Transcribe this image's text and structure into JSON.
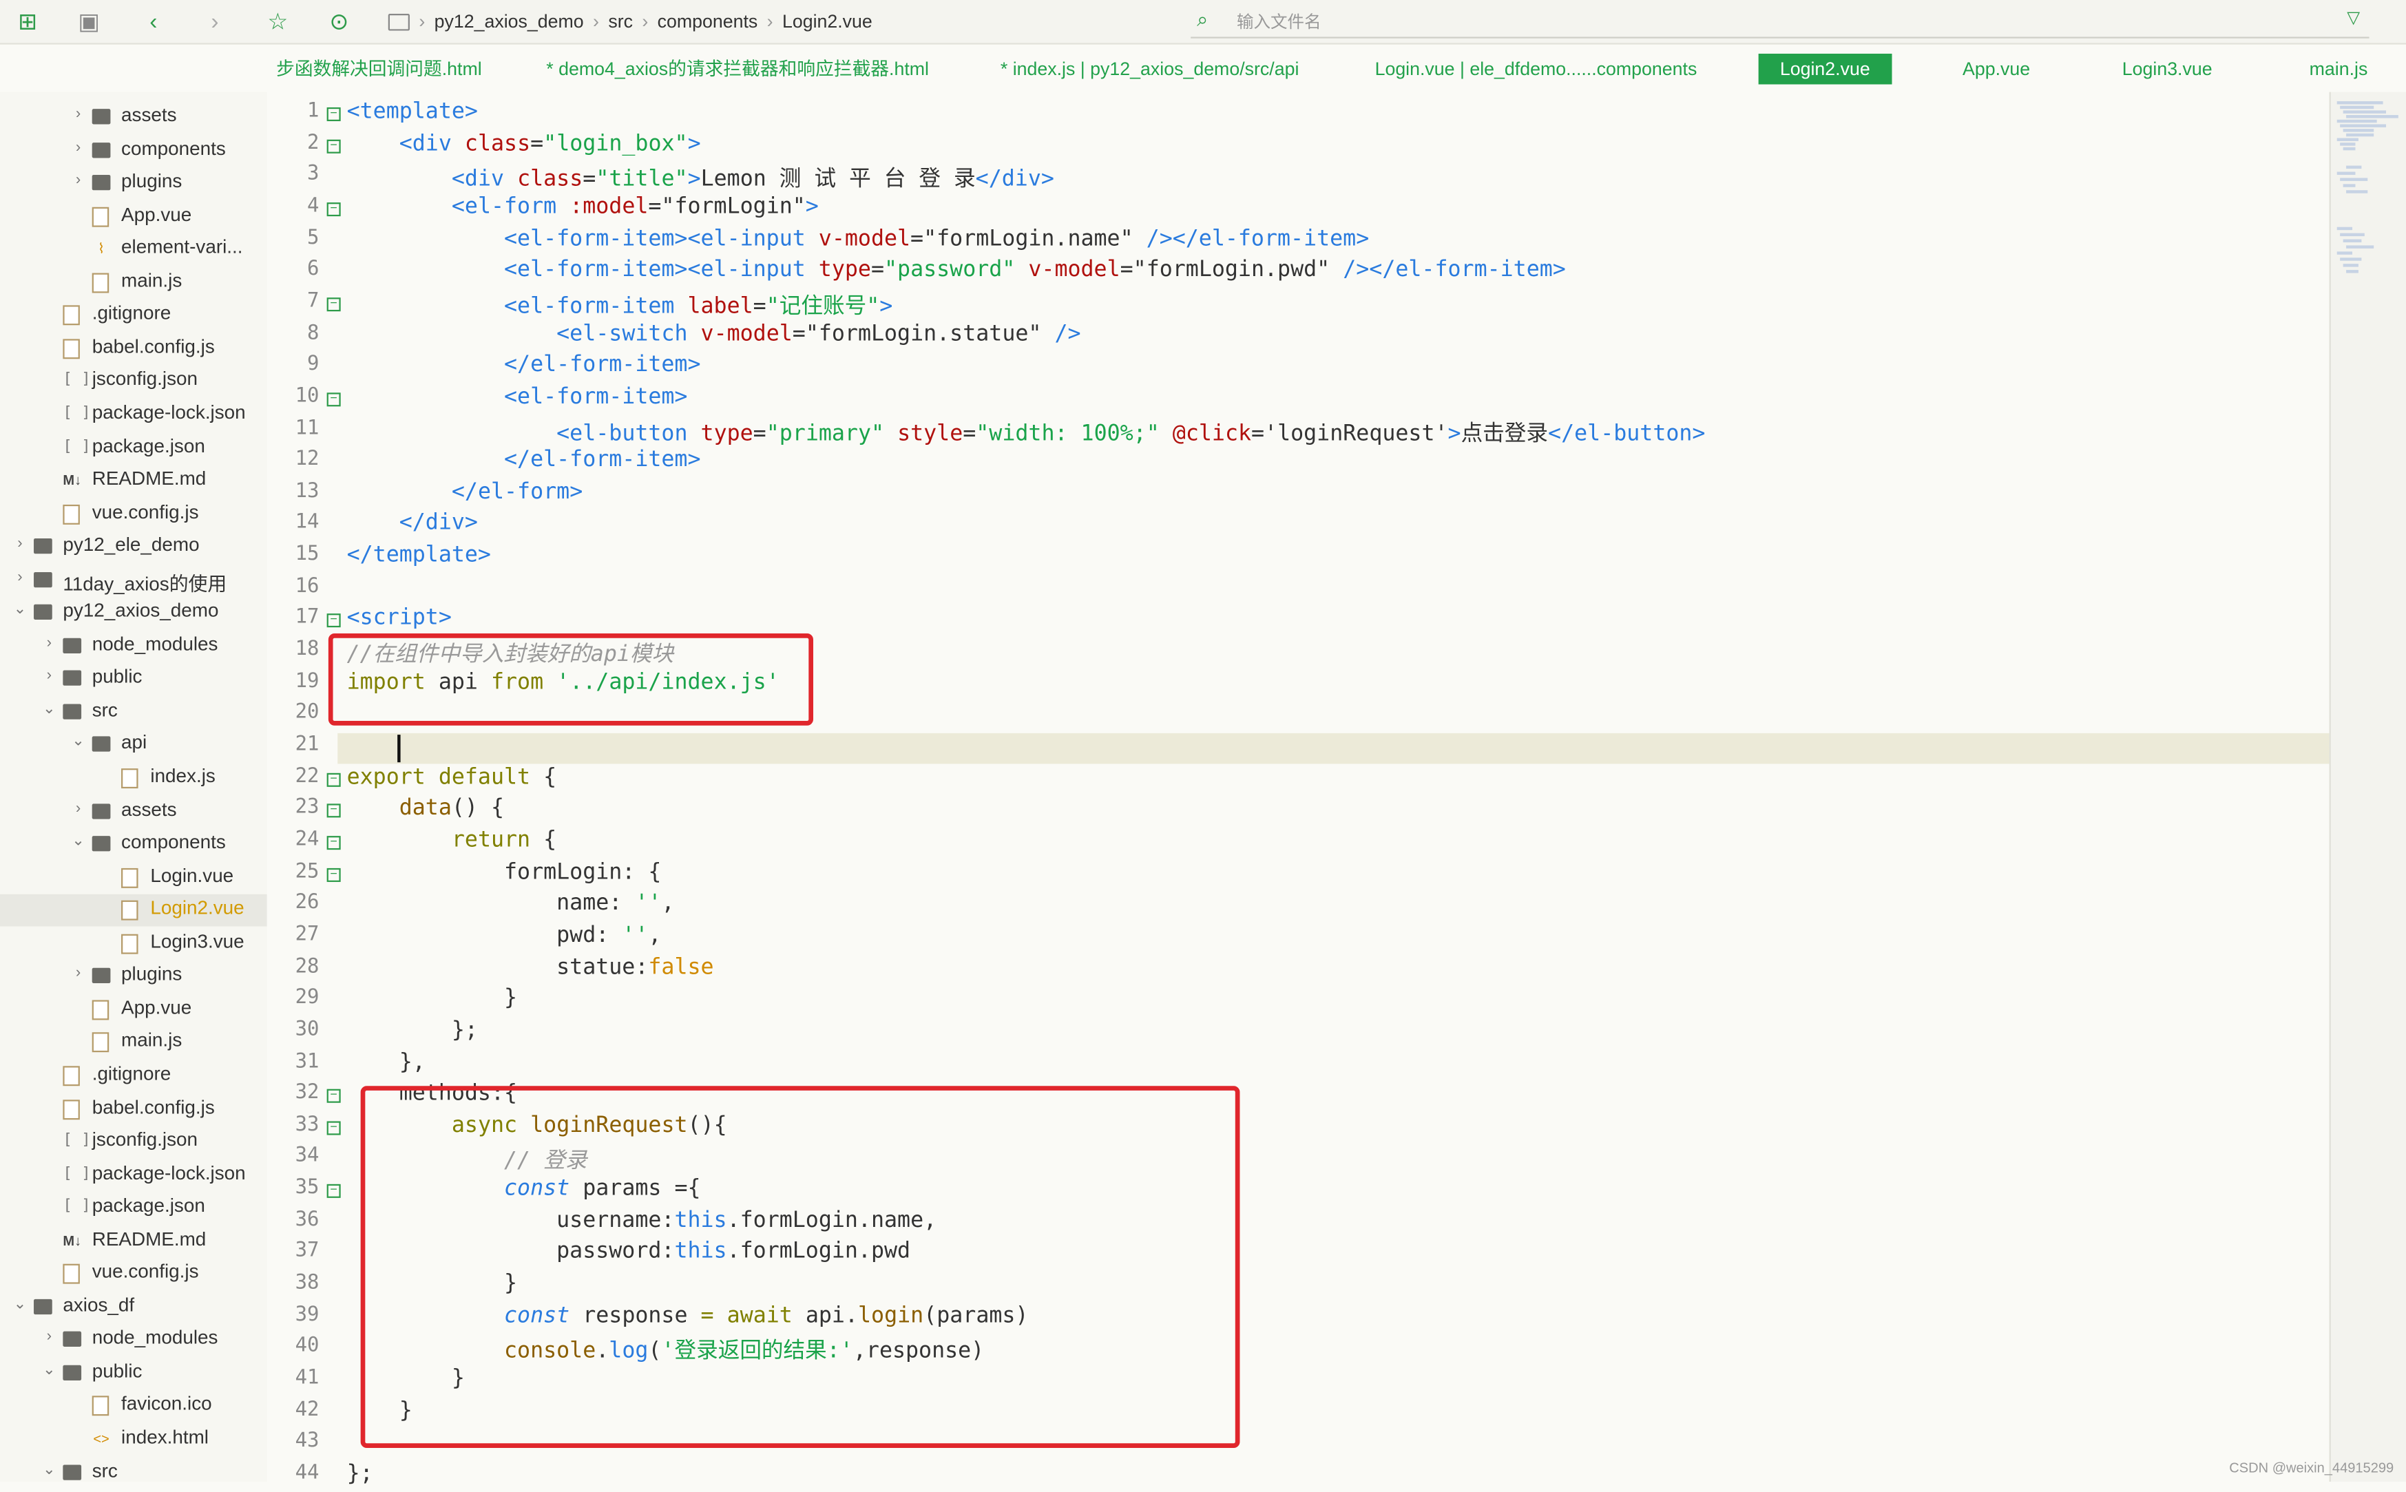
{
  "toolbar": {
    "breadcrumb": [
      "py12_axios_demo",
      "src",
      "components",
      "Login2.vue"
    ],
    "search_placeholder": "输入文件名",
    "icons": [
      "new-file-icon",
      "save-icon",
      "back-icon",
      "forward-icon",
      "star-icon",
      "run-icon",
      "folder-icon",
      "search-file-icon",
      "filter-icon"
    ]
  },
  "tabs": [
    {
      "label": "步函数解决回调问题.html",
      "active": false
    },
    {
      "label": "* demo4_axios的请求拦截器和响应拦截器.html",
      "active": false
    },
    {
      "label": "* index.js | py12_axios_demo/src/api",
      "active": false
    },
    {
      "label": "Login.vue | ele_dfdemo......components",
      "active": false
    },
    {
      "label": "Login2.vue",
      "active": true
    },
    {
      "label": "App.vue",
      "active": false
    },
    {
      "label": "Login3.vue",
      "active": false
    },
    {
      "label": "main.js",
      "active": false
    }
  ],
  "tree": [
    {
      "label": "assets",
      "kind": "folder",
      "depth": 2,
      "chevron": "›"
    },
    {
      "label": "components",
      "kind": "folder",
      "depth": 2,
      "chevron": "›"
    },
    {
      "label": "plugins",
      "kind": "folder",
      "depth": 2,
      "chevron": "›"
    },
    {
      "label": "App.vue",
      "kind": "file",
      "depth": 2,
      "chevron": ""
    },
    {
      "label": "element-vari...",
      "kind": "link",
      "depth": 2,
      "chevron": ""
    },
    {
      "label": "main.js",
      "kind": "file",
      "depth": 2,
      "chevron": ""
    },
    {
      "label": ".gitignore",
      "kind": "file",
      "depth": 1,
      "chevron": ""
    },
    {
      "label": "babel.config.js",
      "kind": "file",
      "depth": 1,
      "chevron": ""
    },
    {
      "label": "jsconfig.json",
      "kind": "json",
      "depth": 1,
      "chevron": ""
    },
    {
      "label": "package-lock.json",
      "kind": "json",
      "depth": 1,
      "chevron": ""
    },
    {
      "label": "package.json",
      "kind": "json",
      "depth": 1,
      "chevron": ""
    },
    {
      "label": "README.md",
      "kind": "md",
      "depth": 1,
      "chevron": ""
    },
    {
      "label": "vue.config.js",
      "kind": "file",
      "depth": 1,
      "chevron": ""
    },
    {
      "label": "py12_ele_demo",
      "kind": "folder",
      "depth": 0,
      "chevron": "›"
    },
    {
      "label": "11day_axios的使用",
      "kind": "folder",
      "depth": 0,
      "chevron": "›"
    },
    {
      "label": "py12_axios_demo",
      "kind": "folder",
      "depth": 0,
      "chevron": "⌄"
    },
    {
      "label": "node_modules",
      "kind": "folder",
      "depth": 1,
      "chevron": "›"
    },
    {
      "label": "public",
      "kind": "folder",
      "depth": 1,
      "chevron": "›"
    },
    {
      "label": "src",
      "kind": "folder",
      "depth": 1,
      "chevron": "⌄"
    },
    {
      "label": "api",
      "kind": "folder",
      "depth": 2,
      "chevron": "⌄"
    },
    {
      "label": "index.js",
      "kind": "file",
      "depth": 3,
      "chevron": ""
    },
    {
      "label": "assets",
      "kind": "folder",
      "depth": 2,
      "chevron": "›"
    },
    {
      "label": "components",
      "kind": "folder",
      "depth": 2,
      "chevron": "⌄"
    },
    {
      "label": "Login.vue",
      "kind": "file",
      "depth": 3,
      "chevron": ""
    },
    {
      "label": "Login2.vue",
      "kind": "file",
      "depth": 3,
      "chevron": "",
      "selected": true
    },
    {
      "label": "Login3.vue",
      "kind": "file",
      "depth": 3,
      "chevron": ""
    },
    {
      "label": "plugins",
      "kind": "folder",
      "depth": 2,
      "chevron": "›"
    },
    {
      "label": "App.vue",
      "kind": "file",
      "depth": 2,
      "chevron": ""
    },
    {
      "label": "main.js",
      "kind": "file",
      "depth": 2,
      "chevron": ""
    },
    {
      "label": ".gitignore",
      "kind": "file",
      "depth": 1,
      "chevron": ""
    },
    {
      "label": "babel.config.js",
      "kind": "file",
      "depth": 1,
      "chevron": ""
    },
    {
      "label": "jsconfig.json",
      "kind": "json",
      "depth": 1,
      "chevron": ""
    },
    {
      "label": "package-lock.json",
      "kind": "json",
      "depth": 1,
      "chevron": ""
    },
    {
      "label": "package.json",
      "kind": "json",
      "depth": 1,
      "chevron": ""
    },
    {
      "label": "README.md",
      "kind": "md",
      "depth": 1,
      "chevron": ""
    },
    {
      "label": "vue.config.js",
      "kind": "file",
      "depth": 1,
      "chevron": ""
    },
    {
      "label": "axios_df",
      "kind": "folder",
      "depth": 0,
      "chevron": "⌄"
    },
    {
      "label": "node_modules",
      "kind": "folder",
      "depth": 1,
      "chevron": "›"
    },
    {
      "label": "public",
      "kind": "folder",
      "depth": 1,
      "chevron": "⌄"
    },
    {
      "label": "favicon.ico",
      "kind": "file",
      "depth": 2,
      "chevron": ""
    },
    {
      "label": "index.html",
      "kind": "html",
      "depth": 2,
      "chevron": ""
    },
    {
      "label": "src",
      "kind": "folder",
      "depth": 1,
      "chevron": "⌄"
    }
  ],
  "code": [
    {
      "n": 1,
      "fold": true,
      "t": [
        [
          "t-tag",
          "<template>"
        ]
      ]
    },
    {
      "n": 2,
      "fold": true,
      "t": [
        [
          "",
          "    "
        ],
        [
          "t-tag",
          "<div "
        ],
        [
          "t-attr",
          "class"
        ],
        [
          "",
          "="
        ],
        [
          "t-str",
          "\"login_box\""
        ],
        [
          "t-tag",
          ">"
        ]
      ]
    },
    {
      "n": 3,
      "fold": false,
      "t": [
        [
          "",
          "        "
        ],
        [
          "t-tag",
          "<div "
        ],
        [
          "t-attr",
          "class"
        ],
        [
          "",
          "="
        ],
        [
          "t-str",
          "\"title\""
        ],
        [
          "t-tag",
          ">"
        ],
        [
          "",
          "Lemon 测 试 平 台 登 录"
        ],
        [
          "t-tag",
          "</div>"
        ]
      ]
    },
    {
      "n": 4,
      "fold": true,
      "t": [
        [
          "",
          "        "
        ],
        [
          "t-tag",
          "<el-form "
        ],
        [
          "t-attr",
          ":model"
        ],
        [
          "",
          "=\"formLogin\""
        ],
        [
          "t-tag",
          ">"
        ]
      ]
    },
    {
      "n": 5,
      "fold": false,
      "t": [
        [
          "",
          "            "
        ],
        [
          "t-tag",
          "<el-form-item><el-input "
        ],
        [
          "t-attr",
          "v-model"
        ],
        [
          "",
          "=\"formLogin.name\" "
        ],
        [
          "t-tag",
          "/></el-form-item>"
        ]
      ]
    },
    {
      "n": 6,
      "fold": false,
      "t": [
        [
          "",
          "            "
        ],
        [
          "t-tag",
          "<el-form-item><el-input "
        ],
        [
          "t-attr",
          "type"
        ],
        [
          "",
          "="
        ],
        [
          "t-str",
          "\"password\""
        ],
        [
          "",
          ""
        ],
        [
          "t-attr",
          " v-model"
        ],
        [
          "",
          "=\"formLogin.pwd\" "
        ],
        [
          "t-tag",
          "/></el-form-item>"
        ]
      ]
    },
    {
      "n": 7,
      "fold": true,
      "t": [
        [
          "",
          "            "
        ],
        [
          "t-tag",
          "<el-form-item "
        ],
        [
          "t-attr",
          "label"
        ],
        [
          "",
          "="
        ],
        [
          "t-str",
          "\"记住账号\""
        ],
        [
          "t-tag",
          ">"
        ]
      ]
    },
    {
      "n": 8,
      "fold": false,
      "t": [
        [
          "",
          "                "
        ],
        [
          "t-tag",
          "<el-switch "
        ],
        [
          "t-attr",
          "v-model"
        ],
        [
          "",
          "=\"formLogin.statue\" "
        ],
        [
          "t-tag",
          "/>"
        ]
      ]
    },
    {
      "n": 9,
      "fold": false,
      "t": [
        [
          "",
          "            "
        ],
        [
          "t-tag",
          "</el-form-item>"
        ]
      ]
    },
    {
      "n": 10,
      "fold": true,
      "t": [
        [
          "",
          "            "
        ],
        [
          "t-tag",
          "<el-form-item>"
        ]
      ]
    },
    {
      "n": 11,
      "fold": false,
      "t": [
        [
          "",
          "                "
        ],
        [
          "t-tag",
          "<el-button "
        ],
        [
          "t-attr",
          "type"
        ],
        [
          "",
          "="
        ],
        [
          "t-str",
          "\"primary\""
        ],
        [
          "t-attr",
          " style"
        ],
        [
          "",
          "="
        ],
        [
          "t-str",
          "\"width: 100%;\""
        ],
        [
          "",
          ""
        ],
        [
          "t-attr",
          " @click"
        ],
        [
          "",
          "='loginRequest'"
        ],
        [
          "t-tag",
          ">"
        ],
        [
          "",
          "点击登录"
        ],
        [
          "t-tag",
          "</el-button>"
        ]
      ]
    },
    {
      "n": 12,
      "fold": false,
      "t": [
        [
          "",
          "            "
        ],
        [
          "t-tag",
          "</el-form-item>"
        ]
      ]
    },
    {
      "n": 13,
      "fold": false,
      "t": [
        [
          "",
          "        "
        ],
        [
          "t-tag",
          "</el-form>"
        ]
      ]
    },
    {
      "n": 14,
      "fold": false,
      "t": [
        [
          "",
          "    "
        ],
        [
          "t-tag",
          "</div>"
        ]
      ]
    },
    {
      "n": 15,
      "fold": false,
      "t": [
        [
          "t-tag",
          "</template>"
        ]
      ]
    },
    {
      "n": 16,
      "fold": false,
      "t": []
    },
    {
      "n": 17,
      "fold": true,
      "t": [
        [
          "t-tag",
          "<script>"
        ]
      ]
    },
    {
      "n": 18,
      "fold": false,
      "t": [
        [
          "t-cm",
          "//在组件中导入封装好的api模块"
        ]
      ]
    },
    {
      "n": 19,
      "fold": false,
      "t": [
        [
          "t-kw",
          "import"
        ],
        [
          "",
          " api "
        ],
        [
          "t-kw",
          "from"
        ],
        [
          "",
          " "
        ],
        [
          "t-str",
          "'../api/index.js'"
        ]
      ]
    },
    {
      "n": 20,
      "fold": false,
      "t": []
    },
    {
      "n": 21,
      "fold": false,
      "t": [],
      "current": true
    },
    {
      "n": 22,
      "fold": true,
      "t": [
        [
          "t-kw",
          "export default"
        ],
        [
          "",
          " {"
        ]
      ]
    },
    {
      "n": 23,
      "fold": true,
      "t": [
        [
          "",
          "    "
        ],
        [
          "t-kwd",
          "data"
        ],
        [
          "",
          "() {"
        ]
      ]
    },
    {
      "n": 24,
      "fold": true,
      "t": [
        [
          "",
          "        "
        ],
        [
          "t-kw",
          "return"
        ],
        [
          "",
          " {"
        ]
      ]
    },
    {
      "n": 25,
      "fold": true,
      "t": [
        [
          "",
          "            formLogin: {"
        ]
      ]
    },
    {
      "n": 26,
      "fold": false,
      "t": [
        [
          "",
          "                name: "
        ],
        [
          "t-str",
          "''"
        ],
        [
          "",
          ","
        ]
      ]
    },
    {
      "n": 27,
      "fold": false,
      "t": [
        [
          "",
          "                pwd: "
        ],
        [
          "t-str",
          "''"
        ],
        [
          "",
          ","
        ]
      ]
    },
    {
      "n": 28,
      "fold": false,
      "t": [
        [
          "",
          "                statue:"
        ],
        [
          "t-bool",
          "false"
        ]
      ]
    },
    {
      "n": 29,
      "fold": false,
      "t": [
        [
          "",
          "            }"
        ]
      ]
    },
    {
      "n": 30,
      "fold": false,
      "t": [
        [
          "",
          "        };"
        ]
      ]
    },
    {
      "n": 31,
      "fold": false,
      "t": [
        [
          "",
          "    },"
        ]
      ]
    },
    {
      "n": 32,
      "fold": true,
      "t": [
        [
          "",
          "    methods:{"
        ]
      ]
    },
    {
      "n": 33,
      "fold": true,
      "t": [
        [
          "",
          "        "
        ],
        [
          "t-kw",
          "async"
        ],
        [
          "",
          " "
        ],
        [
          "t-kwd",
          "loginRequest"
        ],
        [
          "",
          "(){"
        ]
      ]
    },
    {
      "n": 34,
      "fold": false,
      "t": [
        [
          "",
          "            "
        ],
        [
          "t-cm",
          "// 登录"
        ]
      ]
    },
    {
      "n": 35,
      "fold": true,
      "t": [
        [
          "",
          "            "
        ],
        [
          "t-it",
          "const"
        ],
        [
          "",
          " params ={"
        ]
      ]
    },
    {
      "n": 36,
      "fold": false,
      "t": [
        [
          "",
          "                username:"
        ],
        [
          "t-this",
          "this"
        ],
        [
          "",
          ".formLogin.name,"
        ]
      ]
    },
    {
      "n": 37,
      "fold": false,
      "t": [
        [
          "",
          "                password:"
        ],
        [
          "t-this",
          "this"
        ],
        [
          "",
          ".formLogin.pwd"
        ]
      ]
    },
    {
      "n": 38,
      "fold": false,
      "t": [
        [
          "",
          "            }"
        ]
      ]
    },
    {
      "n": 39,
      "fold": false,
      "t": [
        [
          "",
          "            "
        ],
        [
          "t-it",
          "const"
        ],
        [
          "",
          " response "
        ],
        [
          "t-kw",
          "="
        ],
        [
          "",
          " "
        ],
        [
          "t-kw",
          "await"
        ],
        [
          "",
          " api."
        ],
        [
          "t-kwd",
          "login"
        ],
        [
          "",
          "(params)"
        ]
      ]
    },
    {
      "n": 40,
      "fold": false,
      "t": [
        [
          "",
          "            "
        ],
        [
          "t-kwd",
          "console"
        ],
        [
          "",
          "."
        ],
        [
          "t-fn",
          "log"
        ],
        [
          "",
          "("
        ],
        [
          "t-str",
          "'登录返回的结果:'"
        ],
        [
          "",
          ",response)"
        ]
      ]
    },
    {
      "n": 41,
      "fold": false,
      "t": [
        [
          "",
          "        }"
        ]
      ]
    },
    {
      "n": 42,
      "fold": false,
      "t": [
        [
          "",
          "    }"
        ]
      ]
    },
    {
      "n": 43,
      "fold": false,
      "t": []
    },
    {
      "n": 44,
      "fold": false,
      "t": [
        [
          "",
          "};"
        ]
      ]
    }
  ],
  "watermark": "CSDN @weixin_44915299",
  "colors": {
    "accent": "#22a14b",
    "highlight_box": "#e0262c"
  }
}
